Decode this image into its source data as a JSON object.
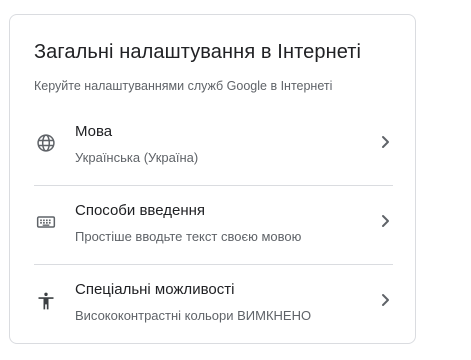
{
  "card": {
    "title": "Загальні налаштування в Інтернеті",
    "subtitle": "Керуйте налаштуваннями служб Google в Інтернеті"
  },
  "rows": [
    {
      "icon": "globe-icon",
      "title": "Мова",
      "description": "Українська (Україна)"
    },
    {
      "icon": "keyboard-icon",
      "title": "Способи введення",
      "description": "Простіше вводьте текст своєю мовою"
    },
    {
      "icon": "accessibility-icon",
      "title": "Спеціальні можливості",
      "description": "Висококонтрастні кольори ВИМКНЕНО"
    }
  ],
  "colors": {
    "text_primary": "#202124",
    "text_secondary": "#5f6368",
    "divider": "#dadce0",
    "icon": "#5f6368"
  }
}
